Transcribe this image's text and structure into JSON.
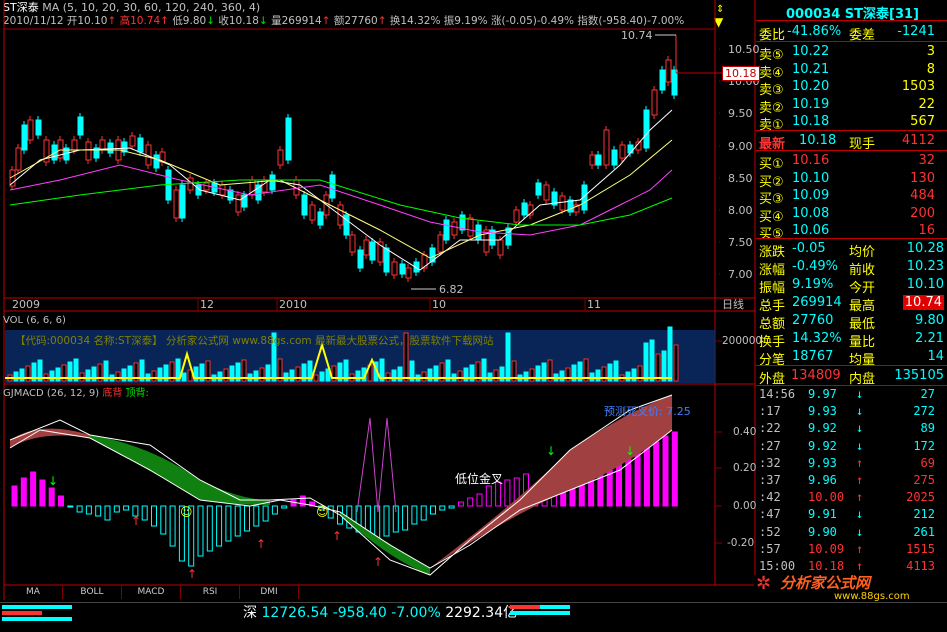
{
  "header": {
    "title": "ST深泰",
    "ma_params": "MA (5, 10, 20, 30, 60, 120, 240, 360, 4)",
    "date": "2010/11/12",
    "open": "开10.10",
    "high": "高10.74",
    "low": "低9.80",
    "close": "收10.18",
    "vol": "量269914",
    "amt": "额27760",
    "turn": "换14.32%",
    "amp": "振9.19%",
    "chg": "涨(-0.05)-0.49%",
    "idx": "指数(-958.40)-7.00%"
  },
  "main_chart": {
    "price_ticks": [
      "10.50",
      "10.00",
      "9.50",
      "9.00",
      "8.50",
      "8.00",
      "7.50",
      "7.00"
    ],
    "high_label": "10.74",
    "low_label": "6.82",
    "cur_price": "10.18",
    "dates": [
      "2009",
      "12",
      "2010",
      "10",
      "11"
    ],
    "period": "日线"
  },
  "volume": {
    "title": "VOL (6, 6, 6)",
    "watermark": "【代码:000034 名称:ST深泰】  分析家公式网 www.88gs.com 最新最大股票公式，股票软件下载网站",
    "tick": "200000"
  },
  "macd": {
    "title": "GJMACD (26, 12, 9)",
    "legend_bottom": "底背",
    "legend_top": "顶背:",
    "ticks": [
      "0.40",
      "0.20",
      "0.00",
      "-0.20"
    ],
    "annot_golden": "低位金叉",
    "annot_predict": "预测死叉价:",
    "predict_val": "7.25"
  },
  "tabs": [
    "MA",
    "BOLL",
    "MACD",
    "RSI",
    "DMI"
  ],
  "status": {
    "market": "深",
    "index": "12726.54",
    "chg": "-958.40",
    "pct": "-7.00%",
    "amount": "2292.34亿"
  },
  "quote": {
    "code_title": "000034 ST深泰[31]",
    "weibi_label": "委比",
    "weibi": "-41.86%",
    "weicha_label": "委差",
    "weicha": "-1241",
    "sells": [
      {
        "label": "卖⑤",
        "price": "10.22",
        "vol": "3"
      },
      {
        "label": "卖④",
        "price": "10.21",
        "vol": "8"
      },
      {
        "label": "卖③",
        "price": "10.20",
        "vol": "1503"
      },
      {
        "label": "卖②",
        "price": "10.19",
        "vol": "22"
      },
      {
        "label": "卖①",
        "price": "10.18",
        "vol": "567"
      }
    ],
    "latest_label": "最新",
    "latest": "10.18",
    "xianshou_label": "现手",
    "xianshou": "4112",
    "buys": [
      {
        "label": "买①",
        "price": "10.16",
        "vol": "32"
      },
      {
        "label": "买②",
        "price": "10.10",
        "vol": "130"
      },
      {
        "label": "买③",
        "price": "10.09",
        "vol": "484"
      },
      {
        "label": "买④",
        "price": "10.08",
        "vol": "200"
      },
      {
        "label": "买⑤",
        "price": "10.06",
        "vol": "16"
      }
    ],
    "stats": [
      {
        "l1": "涨跌",
        "v1": "-0.05",
        "l2": "均价",
        "v2": "10.28"
      },
      {
        "l1": "涨幅",
        "v1": "-0.49%",
        "l2": "前收",
        "v2": "10.23"
      },
      {
        "l1": "振幅",
        "v1": "9.19%",
        "l2": "今开",
        "v2": "10.10"
      },
      {
        "l1": "总手",
        "v1": "269914",
        "l2": "最高",
        "v2": "10.74"
      },
      {
        "l1": "总额",
        "v1": "27760",
        "l2": "最低",
        "v2": "9.80"
      },
      {
        "l1": "换手",
        "v1": "14.32%",
        "l2": "量比",
        "v2": "2.21"
      },
      {
        "l1": "分笔",
        "v1": "18767",
        "l2": "均量",
        "v2": "14"
      }
    ],
    "waipan_label": "外盘",
    "waipan": "134809",
    "neipan_label": "内盘",
    "neipan": "135105",
    "ticks": [
      {
        "t": "14:56",
        "p": "9.97",
        "d": "down",
        "v": "27"
      },
      {
        "t": ":17",
        "p": "9.93",
        "d": "down",
        "v": "272"
      },
      {
        "t": ":22",
        "p": "9.92",
        "d": "down",
        "v": "89"
      },
      {
        "t": ":27",
        "p": "9.92",
        "d": "down",
        "v": "172"
      },
      {
        "t": ":32",
        "p": "9.93",
        "d": "up",
        "v": "69"
      },
      {
        "t": ":37",
        "p": "9.96",
        "d": "up",
        "v": "275"
      },
      {
        "t": ":42",
        "p": "10.00",
        "d": "up",
        "v": "2025"
      },
      {
        "t": ":47",
        "p": "9.91",
        "d": "down",
        "v": "212"
      },
      {
        "t": ":52",
        "p": "9.90",
        "d": "down",
        "v": "261"
      },
      {
        "t": ":57",
        "p": "10.09",
        "d": "up",
        "v": "1515"
      },
      {
        "t": "15:00",
        "p": "10.18",
        "d": "up",
        "v": "4113"
      }
    ]
  },
  "logo": {
    "name": "分析家公式网",
    "url": "www.88gs.com"
  }
}
